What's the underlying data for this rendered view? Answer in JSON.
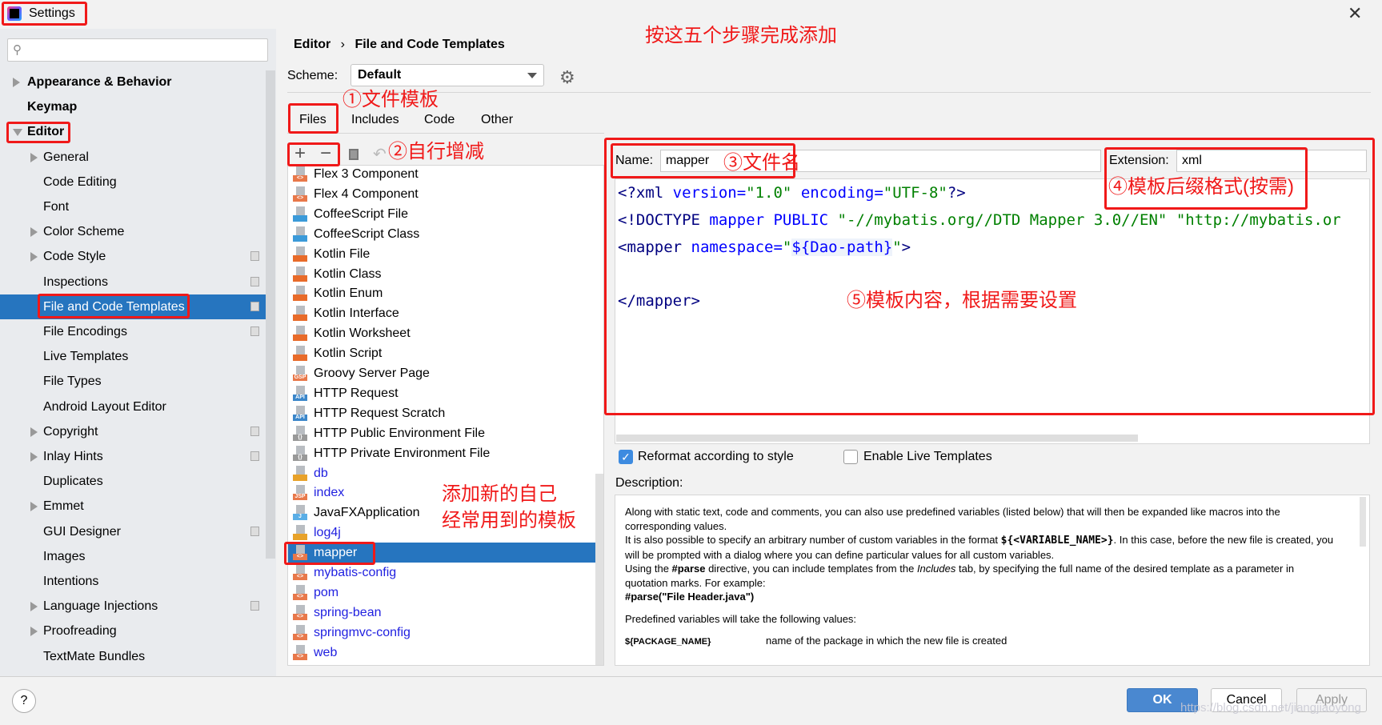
{
  "window": {
    "title": "Settings",
    "close_icon": "close-icon"
  },
  "search": {
    "placeholder": ""
  },
  "sidebar": {
    "items": [
      {
        "label": "Appearance & Behavior",
        "level": 0,
        "arrow": "collapsed",
        "bold": true
      },
      {
        "label": "Keymap",
        "level": 0,
        "bold": true
      },
      {
        "label": "Editor",
        "level": 0,
        "arrow": "expanded",
        "bold": true
      },
      {
        "label": "General",
        "level": 1,
        "arrow": "collapsed"
      },
      {
        "label": "Code Editing",
        "level": 1
      },
      {
        "label": "Font",
        "level": 1
      },
      {
        "label": "Color Scheme",
        "level": 1,
        "arrow": "collapsed"
      },
      {
        "label": "Code Style",
        "level": 1,
        "arrow": "collapsed",
        "project": true
      },
      {
        "label": "Inspections",
        "level": 1,
        "project": true
      },
      {
        "label": "File and Code Templates",
        "level": 1,
        "project": true,
        "selected": true
      },
      {
        "label": "File Encodings",
        "level": 1,
        "project": true
      },
      {
        "label": "Live Templates",
        "level": 1
      },
      {
        "label": "File Types",
        "level": 1
      },
      {
        "label": "Android Layout Editor",
        "level": 1
      },
      {
        "label": "Copyright",
        "level": 1,
        "arrow": "collapsed",
        "project": true
      },
      {
        "label": "Inlay Hints",
        "level": 1,
        "arrow": "collapsed",
        "project": true
      },
      {
        "label": "Duplicates",
        "level": 1
      },
      {
        "label": "Emmet",
        "level": 1,
        "arrow": "collapsed"
      },
      {
        "label": "GUI Designer",
        "level": 1,
        "project": true
      },
      {
        "label": "Images",
        "level": 1
      },
      {
        "label": "Intentions",
        "level": 1
      },
      {
        "label": "Language Injections",
        "level": 1,
        "arrow": "collapsed",
        "project": true
      },
      {
        "label": "Proofreading",
        "level": 1,
        "arrow": "collapsed"
      },
      {
        "label": "TextMate Bundles",
        "level": 1
      }
    ]
  },
  "breadcrumb": {
    "parent": "Editor",
    "separator": "›",
    "current": "File and Code Templates"
  },
  "scheme": {
    "label": "Scheme:",
    "value": "Default"
  },
  "tabs": [
    {
      "label": "Files",
      "active": true
    },
    {
      "label": "Includes"
    },
    {
      "label": "Code"
    },
    {
      "label": "Other"
    }
  ],
  "files": [
    {
      "label": "Flex 3 Component",
      "icon": "xml"
    },
    {
      "label": "Flex 4 Component",
      "icon": "xml"
    },
    {
      "label": "CoffeeScript File",
      "icon": "coffee"
    },
    {
      "label": "CoffeeScript Class",
      "icon": "coffee"
    },
    {
      "label": "Kotlin File",
      "icon": "kotlin"
    },
    {
      "label": "Kotlin Class",
      "icon": "kotlin"
    },
    {
      "label": "Kotlin Enum",
      "icon": "kotlin"
    },
    {
      "label": "Kotlin Interface",
      "icon": "kotlin"
    },
    {
      "label": "Kotlin Worksheet",
      "icon": "kotlin"
    },
    {
      "label": "Kotlin Script",
      "icon": "kotlin"
    },
    {
      "label": "Groovy Server Page",
      "icon": "gsp"
    },
    {
      "label": "HTTP Request",
      "icon": "api"
    },
    {
      "label": "HTTP Request Scratch",
      "icon": "api"
    },
    {
      "label": "HTTP Public Environment File",
      "icon": "env"
    },
    {
      "label": "HTTP Private Environment File",
      "icon": "env"
    },
    {
      "label": "db",
      "icon": "chart",
      "custom": true
    },
    {
      "label": "index",
      "icon": "jsp",
      "custom": true
    },
    {
      "label": "JavaFXApplication",
      "icon": "java"
    },
    {
      "label": "log4j",
      "icon": "chart",
      "custom": true
    },
    {
      "label": "mapper",
      "icon": "xml",
      "custom": true,
      "selected": true
    },
    {
      "label": "mybatis-config",
      "icon": "xml",
      "custom": true
    },
    {
      "label": "pom",
      "icon": "xml",
      "custom": true
    },
    {
      "label": "spring-bean",
      "icon": "xml",
      "custom": true
    },
    {
      "label": "springmvc-config",
      "icon": "xml",
      "custom": true
    },
    {
      "label": "web",
      "icon": "xml",
      "custom": true
    }
  ],
  "template": {
    "name_label": "Name:",
    "name": "mapper",
    "ext_label": "Extension:",
    "ext": "xml",
    "code": [
      [
        [
          "<?",
          "tag"
        ],
        [
          "xml ",
          "tag"
        ],
        [
          "version=",
          "attr"
        ],
        [
          "\"1.0\"",
          "val"
        ],
        [
          " encoding=",
          "attr"
        ],
        [
          "\"UTF-8\"",
          "val"
        ],
        [
          "?>",
          "tag"
        ]
      ],
      [
        [
          "<!DOCTYPE ",
          "tag"
        ],
        [
          "mapper ",
          "attr"
        ],
        [
          "PUBLIC ",
          "attr"
        ],
        [
          "\"-//mybatis.org//DTD Mapper 3.0//EN\"",
          "val"
        ],
        [
          " ",
          "plain"
        ],
        [
          "\"http://mybatis.or",
          "val"
        ]
      ],
      [
        [
          "<",
          "tag"
        ],
        [
          "mapper ",
          "tag"
        ],
        [
          "namespace=",
          "attr"
        ],
        [
          "\"",
          "val"
        ],
        [
          "${Dao-path}",
          "var"
        ],
        [
          "\"",
          "val"
        ],
        [
          ">",
          "tag"
        ]
      ],
      [],
      [
        [
          "</",
          "tag"
        ],
        [
          "mapper",
          "tag"
        ],
        [
          ">",
          "tag"
        ]
      ]
    ]
  },
  "options": {
    "reformat": {
      "label": "Reformat according to style",
      "checked": true
    },
    "live": {
      "label": "Enable Live Templates",
      "checked": false
    }
  },
  "description": {
    "label": "Description:",
    "p1": "Along with static text, code and comments, you can also use predefined variables (listed below) that will then be expanded like macros into the corresponding values.",
    "p2a": "It is also possible to specify an arbitrary number of custom variables in the format ",
    "p2b": "${<VARIABLE_NAME>}",
    "p2c": ". In this case, before the new file is created, you will be prompted with a dialog where you can define particular values for all custom variables.",
    "p3a": "Using the ",
    "p3b": "#parse",
    "p3c": " directive, you can include templates from the ",
    "p3d": "Includes",
    "p3e": " tab, by specifying the full name of the desired template as a parameter in quotation marks. For example:",
    "p4": "#parse(\"File Header.java\")",
    "p5": "Predefined variables will take the following values:",
    "var_name": "${PACKAGE_NAME}",
    "var_desc": "name of the package in which the new file is created"
  },
  "buttons": {
    "ok": "OK",
    "cancel": "Cancel",
    "apply": "Apply",
    "help": "?"
  },
  "annotations": {
    "title": "按这五个步骤完成添加",
    "s1": "①文件模板",
    "s2": "②自行增减",
    "s3": "③文件名",
    "s4": "④模板后缀格式(按需)",
    "s5": "⑤模板内容，根据需要设置",
    "note1": "添加新的自己",
    "note2": "经常用到的模板"
  },
  "watermark": "https://blog.csdn.net/jiangjiaoyong",
  "colors": {
    "accent": "#2675bf",
    "annotation": "#f01919",
    "custom_template": "#1f1fe0"
  }
}
